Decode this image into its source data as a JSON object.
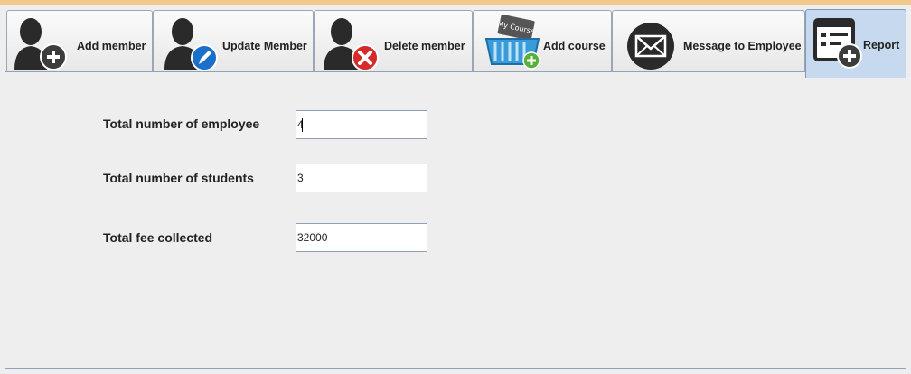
{
  "tabs": [
    {
      "label": "Add member",
      "icon": "add-member-icon"
    },
    {
      "label": "Update Member",
      "icon": "update-member-icon"
    },
    {
      "label": "Delete member",
      "icon": "delete-member-icon"
    },
    {
      "label": "Add course",
      "icon": "add-course-icon",
      "badge_text": "My Course"
    },
    {
      "label": "Message to Employee",
      "icon": "mail-icon"
    },
    {
      "label": "Report",
      "icon": "report-icon",
      "active": true
    }
  ],
  "report": {
    "employees_label": "Total number of employee",
    "employees_value": "4",
    "students_label": "Total number of students",
    "students_value": "3",
    "fee_label": "Total fee collected",
    "fee_value": "32000"
  },
  "colors": {
    "active_tab": "#c6d9ee",
    "window_accent": "#f3c98b",
    "update_badge": "#1a6fc9",
    "delete_badge": "#d52b2b",
    "add_badge": "#3f3f3f",
    "course_badge": "#55b13a"
  }
}
